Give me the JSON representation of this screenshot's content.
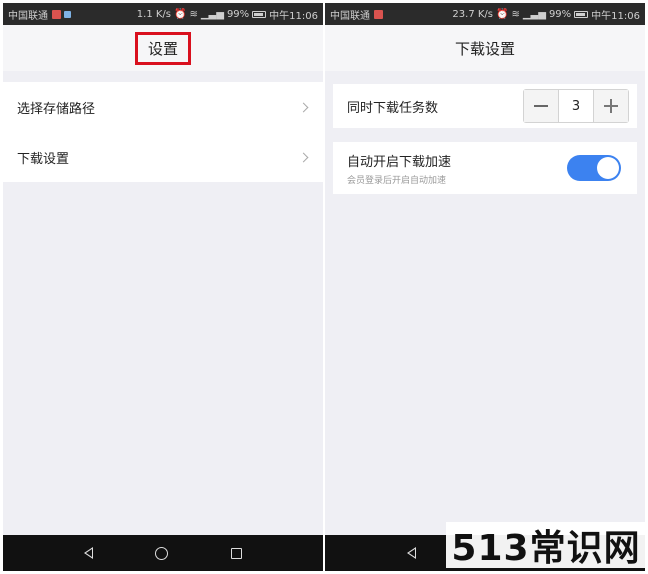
{
  "left_screen": {
    "status": {
      "carrier": "中国联通",
      "speed": "1.1 K/s",
      "battery": "99%",
      "time": "中午11:06"
    },
    "title": "设置",
    "items": [
      {
        "label": "选择存储路径"
      },
      {
        "label": "下载设置"
      }
    ]
  },
  "right_screen": {
    "status": {
      "carrier": "中国联通",
      "speed": "23.7 K/s",
      "battery": "99%",
      "time": "中午11:06"
    },
    "title": "下载设置",
    "concurrent": {
      "label": "同时下载任务数",
      "value": "3"
    },
    "accel": {
      "label": "自动开启下载加速",
      "sub": "会员登录后开启自动加速",
      "enabled": true
    }
  },
  "watermark": "513常识网",
  "colors": {
    "accent": "#3c82f0",
    "highlight_border": "#d9101e"
  }
}
